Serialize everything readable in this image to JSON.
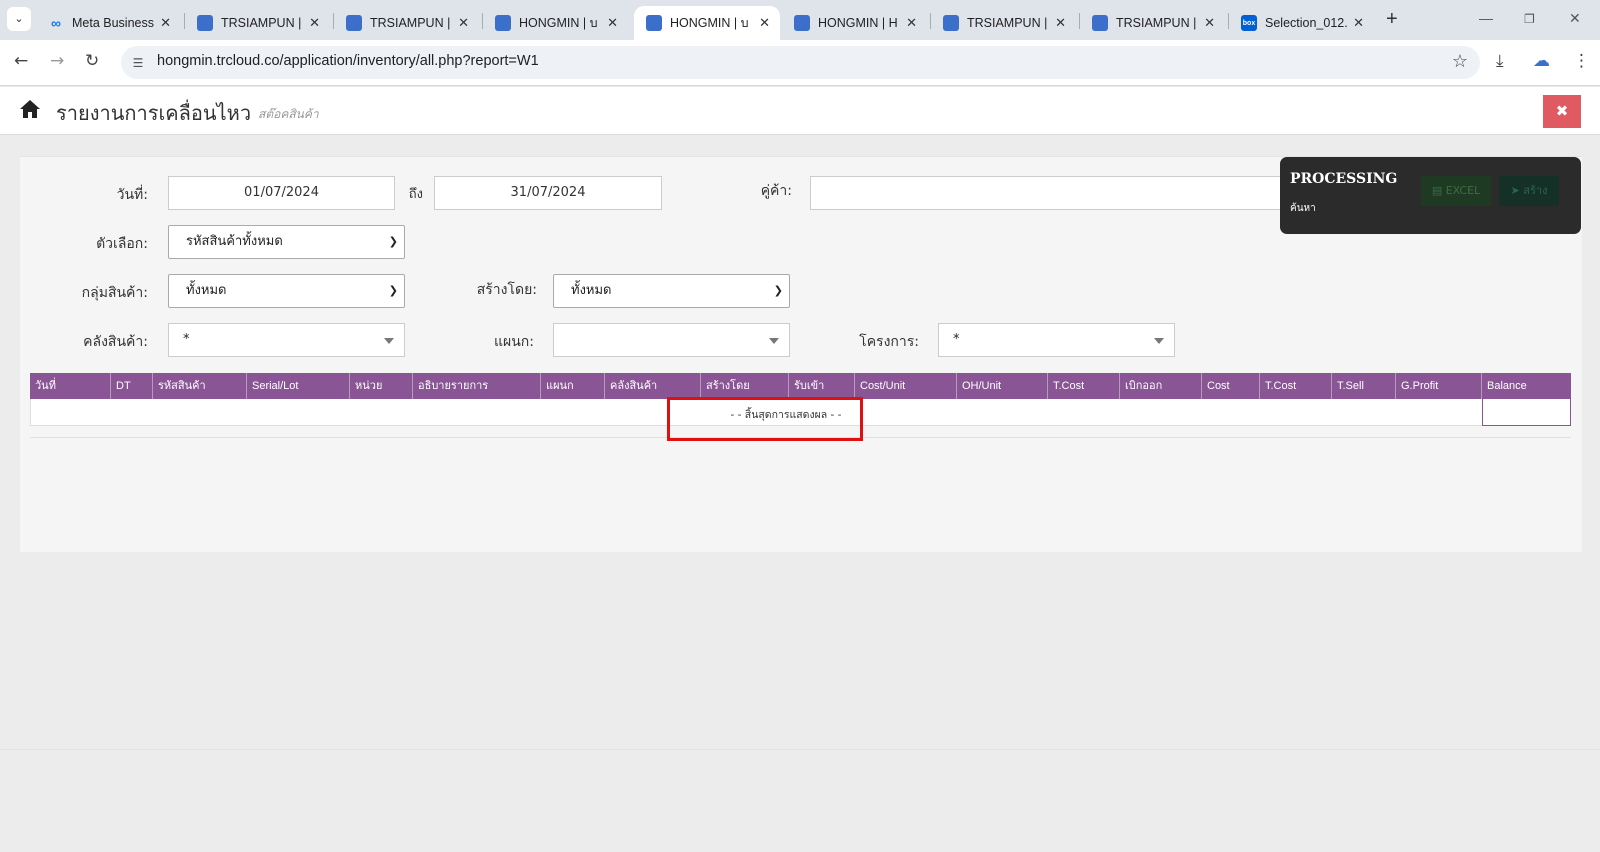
{
  "browser": {
    "tabs": [
      {
        "label": "Meta Business",
        "icon": "meta-icon"
      },
      {
        "label": "TRSIAMPUN | ",
        "icon": "cloud-icon"
      },
      {
        "label": "TRSIAMPUN | ",
        "icon": "cloud-icon"
      },
      {
        "label": "HONGMIN | บ",
        "icon": "cloud-icon"
      },
      {
        "label": "HONGMIN | บ",
        "icon": "cloud-icon",
        "active": true
      },
      {
        "label": "HONGMIN | H",
        "icon": "cloud-icon"
      },
      {
        "label": "TRSIAMPUN | ",
        "icon": "cloud-icon"
      },
      {
        "label": "TRSIAMPUN | ",
        "icon": "cloud-icon"
      },
      {
        "label": "Selection_012.",
        "icon": "box-icon"
      }
    ],
    "url": "hongmin.trcloud.co/application/inventory/all.php?report=W1"
  },
  "header": {
    "title": "รายงานการเคลื่อนไหว",
    "subtitle": "สต๊อคสินค้า"
  },
  "filters": {
    "date_label": "วันที่:",
    "date_from": "01/07/2024",
    "to_label": "ถึง",
    "date_to": "31/07/2024",
    "customer_label": "คู่ค้า:",
    "customer_value": "",
    "option_label": "ตัวเลือก:",
    "option_value": "รหัสสินค้าทั้งหมด",
    "group_label": "กลุ่มสินค้า:",
    "group_value": "ทั้งหมด",
    "created_by_label": "สร้างโดย:",
    "created_by_value": "ทั้งหมด",
    "warehouse_label": "คลังสินค้า:",
    "warehouse_value": "*",
    "department_label": "แผนก:",
    "department_value": "",
    "project_label": "โครงการ:",
    "project_value": "*"
  },
  "table": {
    "columns": [
      "วันที่",
      "DT",
      "รหัสสินค้า",
      "Serial/Lot",
      "หน่วย",
      "อธิบายรายการ",
      "แผนก",
      "คลังสินค้า",
      "สร้างโดย",
      "รับเข้า",
      "Cost/Unit",
      "OH/Unit",
      "T.Cost",
      "เบิกออก",
      "Cost",
      "T.Cost",
      "T.Sell",
      "G.Profit",
      "Balance"
    ],
    "end_text": "- - สิ้นสุดการแสดงผล - -"
  },
  "processing": {
    "title": "PROCESSING",
    "subtitle": "ค้นหา",
    "excel_label": "EXCEL",
    "create_label": "สร้าง"
  },
  "colors": {
    "table_header": "#8a5595",
    "close_button": "#e05a62",
    "highlight": "#e01010"
  }
}
